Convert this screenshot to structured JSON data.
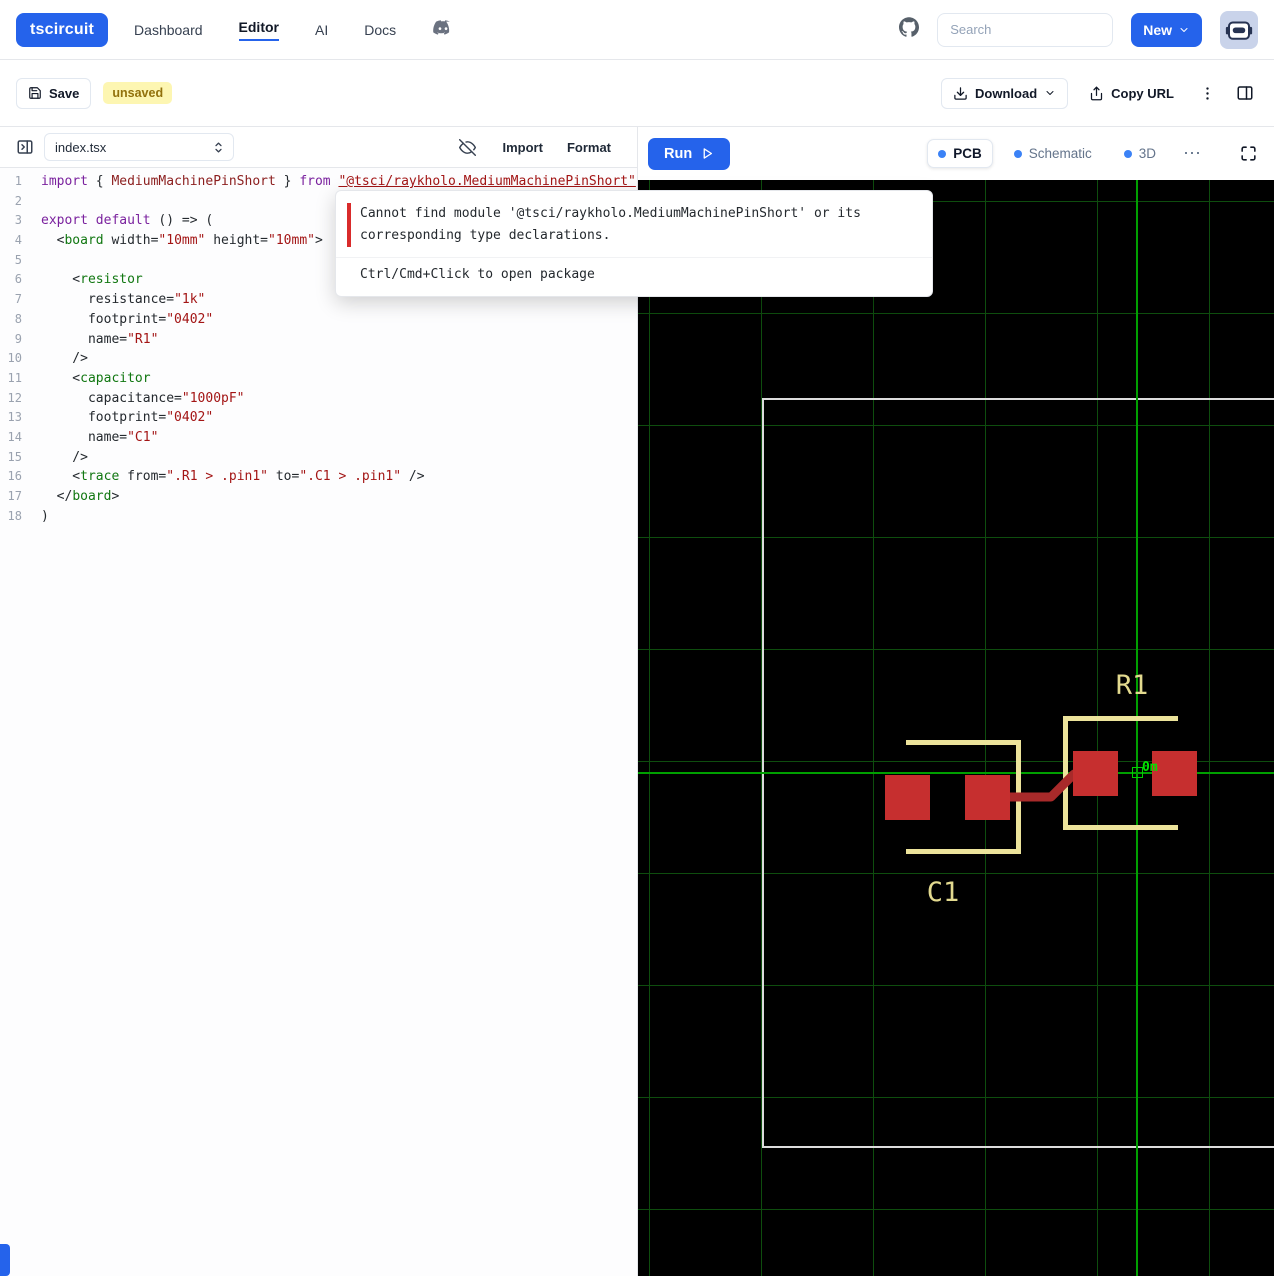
{
  "navbar": {
    "logo": "tscircuit",
    "items": [
      {
        "label": "Dashboard",
        "active": false
      },
      {
        "label": "Editor",
        "active": true
      },
      {
        "label": "AI",
        "active": false
      },
      {
        "label": "Docs",
        "active": false
      }
    ],
    "search_placeholder": "Search",
    "new_button": "New"
  },
  "toolbar": {
    "save_label": "Save",
    "unsaved_badge": "unsaved",
    "download_label": "Download",
    "copy_url_label": "Copy URL"
  },
  "editor": {
    "file_name": "index.tsx",
    "import_label": "Import",
    "format_label": "Format",
    "lines": [
      [
        [
          "import",
          "k"
        ],
        [
          " { ",
          "p"
        ],
        [
          "MediumMachinePinShort",
          "d"
        ],
        [
          " } ",
          "p"
        ],
        [
          "from",
          "k"
        ],
        [
          " ",
          "p"
        ],
        [
          "\"@tsci/raykholo.MediumMachinePinShort\"",
          "su"
        ]
      ],
      [],
      [
        [
          "export",
          "k"
        ],
        [
          " ",
          "p"
        ],
        [
          "default",
          "k"
        ],
        [
          " () => (",
          "p"
        ]
      ],
      [
        [
          "  <",
          "p"
        ],
        [
          "board",
          "t"
        ],
        [
          " width=",
          "p"
        ],
        [
          "\"10mm\"",
          "s"
        ],
        [
          " height=",
          "p"
        ],
        [
          "\"10mm\"",
          "s"
        ],
        [
          ">",
          "p"
        ]
      ],
      [],
      [
        [
          "    <",
          "p"
        ],
        [
          "resistor",
          "t"
        ]
      ],
      [
        [
          "      resistance=",
          "p"
        ],
        [
          "\"1k\"",
          "s"
        ]
      ],
      [
        [
          "      footprint=",
          "p"
        ],
        [
          "\"0402\"",
          "s"
        ]
      ],
      [
        [
          "      name=",
          "p"
        ],
        [
          "\"R1\"",
          "s"
        ]
      ],
      [
        [
          "    />",
          "p"
        ]
      ],
      [
        [
          "    <",
          "p"
        ],
        [
          "capacitor",
          "t"
        ]
      ],
      [
        [
          "      capacitance=",
          "p"
        ],
        [
          "\"1000pF\"",
          "s"
        ]
      ],
      [
        [
          "      footprint=",
          "p"
        ],
        [
          "\"0402\"",
          "s"
        ]
      ],
      [
        [
          "      name=",
          "p"
        ],
        [
          "\"C1\"",
          "s"
        ]
      ],
      [
        [
          "    />",
          "p"
        ]
      ],
      [
        [
          "    <",
          "p"
        ],
        [
          "trace",
          "t"
        ],
        [
          " from=",
          "p"
        ],
        [
          "\".R1 > .pin1\"",
          "s"
        ],
        [
          " to=",
          "p"
        ],
        [
          "\".C1 > .pin1\"",
          "s"
        ],
        [
          " />",
          "p"
        ]
      ],
      [
        [
          "  </",
          "p"
        ],
        [
          "board",
          "t"
        ],
        [
          ">",
          "p"
        ]
      ],
      [
        [
          ")",
          "p"
        ]
      ]
    ]
  },
  "tooltip": {
    "error_text": "Cannot find module '@tsci/raykholo.MediumMachinePinShort' or its corresponding type declarations.",
    "hint_text": "Ctrl/Cmd+Click to open package"
  },
  "viewer": {
    "run_label": "Run",
    "tabs": [
      {
        "label": "PCB",
        "active": true
      },
      {
        "label": "Schematic",
        "active": false
      },
      {
        "label": "3D",
        "active": false
      }
    ],
    "more_label": "⋯"
  },
  "pcb": {
    "labels": {
      "r1": "R1",
      "c1": "C1",
      "origin": "0m"
    },
    "colors": {
      "background": "#000000",
      "grid": "#0e4d0e",
      "crosshair": "#00a000",
      "board_outline": "#dcdcdc",
      "pad": "#c62f2f",
      "trace": "#a82a2a",
      "silkscreen": "#ece39b",
      "label": "#e3da8f"
    }
  }
}
